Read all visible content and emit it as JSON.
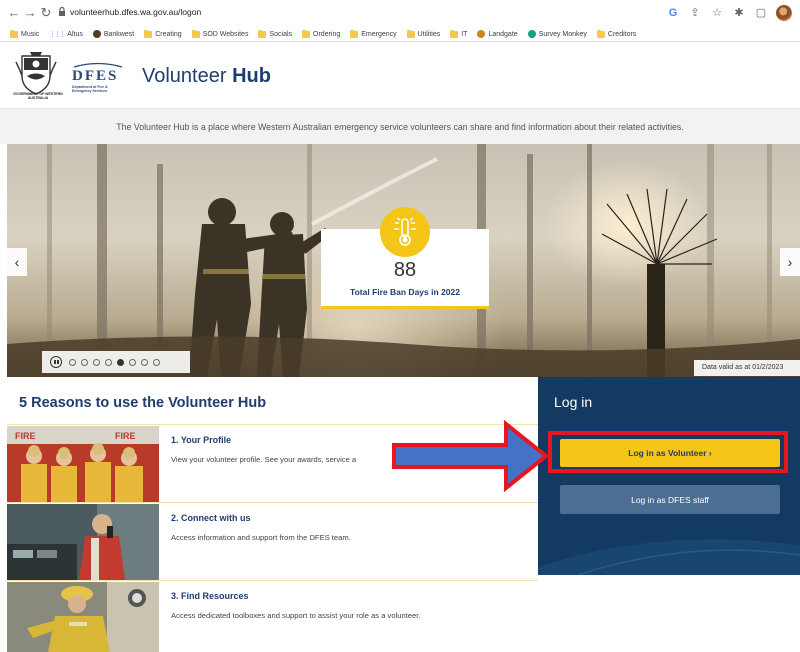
{
  "browser": {
    "url": "volunteerhub.dfes.wa.gov.au/logon",
    "bookmarks": [
      {
        "label": "Music",
        "icon": "folder-icon"
      },
      {
        "label": "Altus",
        "icon": "grid-icon"
      },
      {
        "label": "Bankwest",
        "icon": "bankwest-icon"
      },
      {
        "label": "Creating",
        "icon": "folder-icon"
      },
      {
        "label": "SOD Websites",
        "icon": "folder-icon"
      },
      {
        "label": "Socials",
        "icon": "folder-icon"
      },
      {
        "label": "Ordering",
        "icon": "folder-icon"
      },
      {
        "label": "Emergency",
        "icon": "folder-icon"
      },
      {
        "label": "Utilities",
        "icon": "folder-icon"
      },
      {
        "label": "IT",
        "icon": "folder-icon"
      },
      {
        "label": "Landgate",
        "icon": "landgate-icon"
      },
      {
        "label": "Survey Monkey",
        "icon": "surveymonkey-icon"
      },
      {
        "label": "Creditors",
        "icon": "folder-icon"
      }
    ]
  },
  "header": {
    "gov_text": "GOVERNMENT OF WESTERN AUSTRALIA",
    "dfes_word": "DFES",
    "dfes_sub": "Department of Fire & Emergency Services",
    "title_light": "Volunteer ",
    "title_bold": "Hub"
  },
  "tagline": "The Volunteer Hub is a place where Western Australian emergency service volunteers can share and find information about their related activities.",
  "hero": {
    "prev": "‹",
    "next": "›",
    "stat_number": "88",
    "stat_label": "Total Fire Ban Days in 2022",
    "data_valid": "Data valid as at 01/2/2023",
    "slide_count": 8,
    "active_slide": 5
  },
  "reasons": {
    "title": "5 Reasons to use the Volunteer Hub",
    "items": [
      {
        "title": "1. Your Profile",
        "text": "View your volunteer profile. See your awards, service a"
      },
      {
        "title": "2. Connect with us",
        "text": "Access information and support from the DFES team."
      },
      {
        "title": "3. Find Resources",
        "text": "Access dedicated toolboxes and support to assist your role as a volunteer."
      }
    ]
  },
  "login": {
    "title": "Log in",
    "volunteer_label": "Log in as Volunteer  ›",
    "staff_label": "Log in as DFES staff"
  },
  "colors": {
    "brand_navy": "#1f3d6d",
    "panel": "#123a63",
    "accent_yellow": "#f5c518",
    "highlight_red": "#e8141e",
    "arrow_blue": "#4472c4"
  }
}
